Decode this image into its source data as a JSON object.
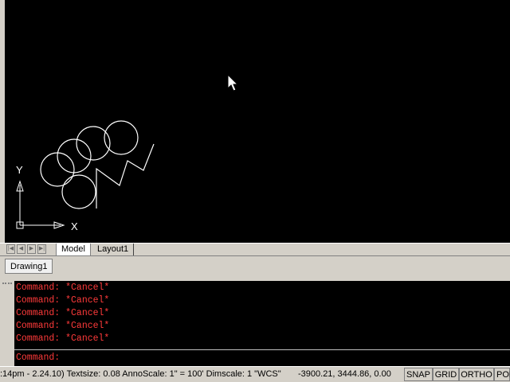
{
  "canvas": {
    "bg_color": "#000000",
    "line_color": "#ffffff",
    "ucs_x_label": "X",
    "ucs_y_label": "Y",
    "cursor_icon": "arrow-cursor-icon"
  },
  "layout_tabs": {
    "nav_icons": [
      "first-tab-icon",
      "prev-tab-icon",
      "next-tab-icon",
      "last-tab-icon"
    ],
    "tabs": [
      {
        "label": "Model",
        "active": true
      },
      {
        "label": "Layout1",
        "active": false
      }
    ]
  },
  "document_tabs": [
    {
      "label": "Drawing1"
    }
  ],
  "command_window": {
    "history": [
      "Command: *Cancel*",
      "Command: *Cancel*",
      "Command: *Cancel*",
      "Command: *Cancel*",
      "Command: *Cancel*"
    ],
    "prompt": "Command:",
    "text_color": "#ff3a3a"
  },
  "status_bar": {
    "info": ":14pm - 2.24.10)  Textsize: 0.08   AnnoScale: 1\" = 100'  Dimscale: 1   \"WCS\"",
    "coordinates": "-3900.21, 3444.86, 0.00",
    "toggles": [
      "SNAP",
      "GRID",
      "ORTHO",
      "POL"
    ]
  }
}
